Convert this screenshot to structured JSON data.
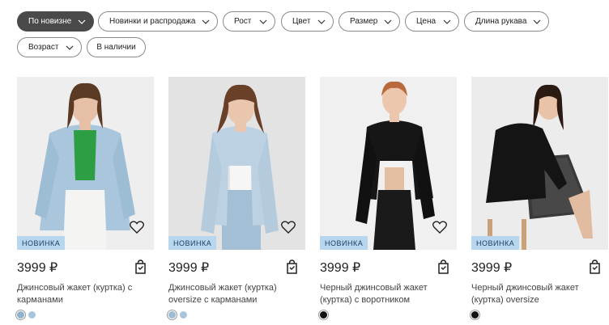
{
  "filters": [
    {
      "label": "По новизне",
      "active": true
    },
    {
      "label": "Новинки и распродажа",
      "active": false
    },
    {
      "label": "Рост",
      "active": false
    },
    {
      "label": "Цвет",
      "active": false
    },
    {
      "label": "Размер",
      "active": false
    },
    {
      "label": "Цена",
      "active": false
    },
    {
      "label": "Длина рукава",
      "active": false
    },
    {
      "label": "Возраст",
      "active": false
    },
    {
      "label": "В наличии",
      "active": false
    }
  ],
  "products": [
    {
      "badge": "НОВИНКА",
      "price": "3999 ₽",
      "title": "Джинсовый жакет (куртка) с карманами",
      "photo_bg": "#eeeeee",
      "swatch_colors": [
        "#8fb3cf",
        "#a8c5dd"
      ]
    },
    {
      "badge": "НОВИНКА",
      "price": "3999 ₽",
      "title": "Джинсовый жакет (куртка) oversize с карманами",
      "photo_bg": "#e3e3e3",
      "swatch_colors": [
        "#9fbcd4",
        "#a8c5dd"
      ]
    },
    {
      "badge": "НОВИНКА",
      "price": "3999 ₽",
      "title": "Черный джинсовый жакет (куртка) с воротником",
      "photo_bg": "#f0f0f0",
      "swatch_colors": [
        "#111111"
      ]
    },
    {
      "badge": "НОВИНКА",
      "price": "3999 ₽",
      "title": "Черный джинсовый жакет (куртка) oversize",
      "photo_bg": "#ececec",
      "swatch_colors": [
        "#111111"
      ]
    }
  ],
  "icons": {
    "chevron": "chevron-down-icon",
    "favorite": "heart-icon",
    "cart": "shopping-bag-icon"
  },
  "colors": {
    "active_chip": "#4a4a4a",
    "badge_bg": "#b9d6ef",
    "badge_text": "#1b3f63"
  }
}
